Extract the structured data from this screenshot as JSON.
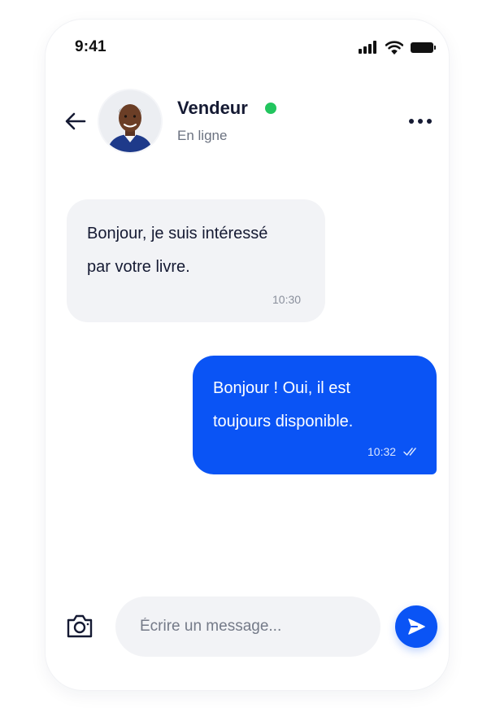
{
  "status_bar": {
    "time": "9:41",
    "icons": [
      "signal-icon",
      "wifi-icon",
      "battery-icon"
    ]
  },
  "header": {
    "back_icon": "arrow-left-icon",
    "contact_name": "Vendeur",
    "contact_status": "En ligne",
    "online_indicator_color": "#22c55e",
    "more_icon": "more-horizontal-icon"
  },
  "messages": [
    {
      "direction": "incoming",
      "lines": [
        "Bonjour, je suis intéressé",
        "par votre livre."
      ],
      "time": "10:30"
    },
    {
      "direction": "outgoing",
      "lines": [
        "Bonjour ! Oui, il est",
        "toujours disponible."
      ],
      "time": "10:32",
      "status_icon": "double-check-icon"
    }
  ],
  "composer": {
    "camera_icon": "camera-icon",
    "placeholder": "Écrire un message...",
    "value": "",
    "send_icon": "send-icon"
  },
  "colors": {
    "accent": "#0a54f5",
    "incoming_bubble": "#f2f3f6",
    "text_primary": "#151a33",
    "text_secondary": "#6b7280"
  }
}
